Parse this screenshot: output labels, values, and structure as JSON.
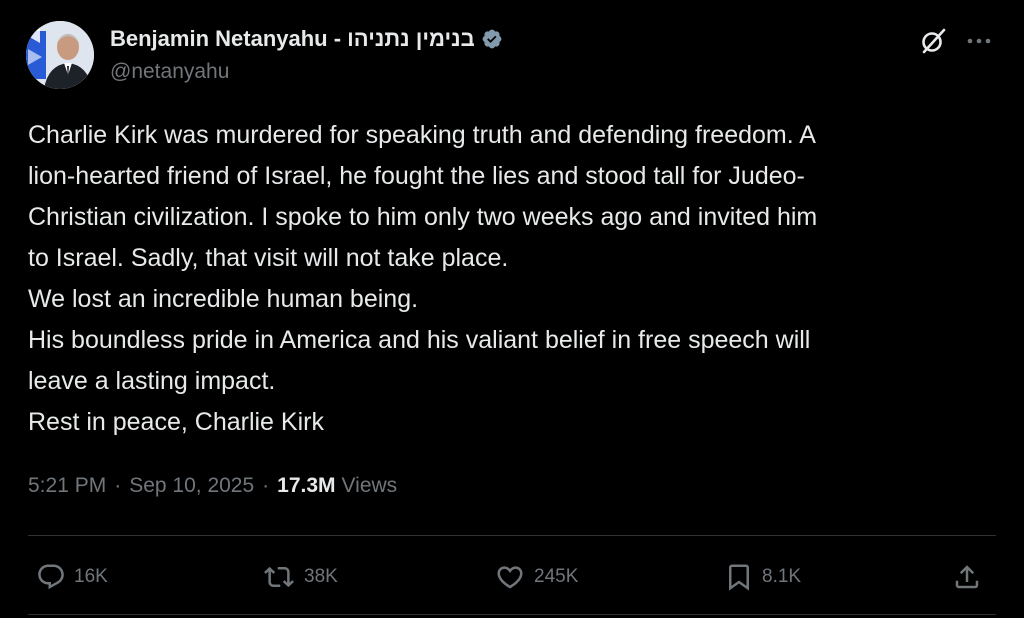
{
  "author": {
    "display_name": "Benjamin Netanyahu - בנימין נתניהו",
    "handle": "@netanyahu",
    "verified": true
  },
  "tweet": {
    "lines": [
      "Charlie Kirk was murdered for speaking truth and defending freedom. A",
      "lion-hearted friend of Israel, he fought the lies and stood tall for Judeo-",
      "Christian civilization. I spoke to him only two weeks ago and invited him",
      "to Israel. Sadly, that visit will not take place.",
      "We lost an incredible human being.",
      "His boundless pride in America and his valiant belief in free speech will",
      "leave a lasting impact.",
      "Rest in peace, Charlie Kirk"
    ]
  },
  "meta": {
    "time": "5:21 PM",
    "separator": "·",
    "date": "Sep 10, 2025",
    "views_count": "17.3M",
    "views_label": "Views"
  },
  "actions": {
    "replies": "16K",
    "reposts": "38K",
    "likes": "245K",
    "bookmarks": "8.1K"
  },
  "icons": {
    "header": [
      "grok-icon",
      "more-options-icon"
    ],
    "actions": [
      "reply-icon",
      "repost-icon",
      "like-icon",
      "bookmark-icon",
      "share-icon"
    ]
  },
  "colors": {
    "background": "#000000",
    "text_primary": "#e7e9ea",
    "text_secondary": "#71767b",
    "verified_badge": "#829aab",
    "divider": "#2f3336"
  }
}
